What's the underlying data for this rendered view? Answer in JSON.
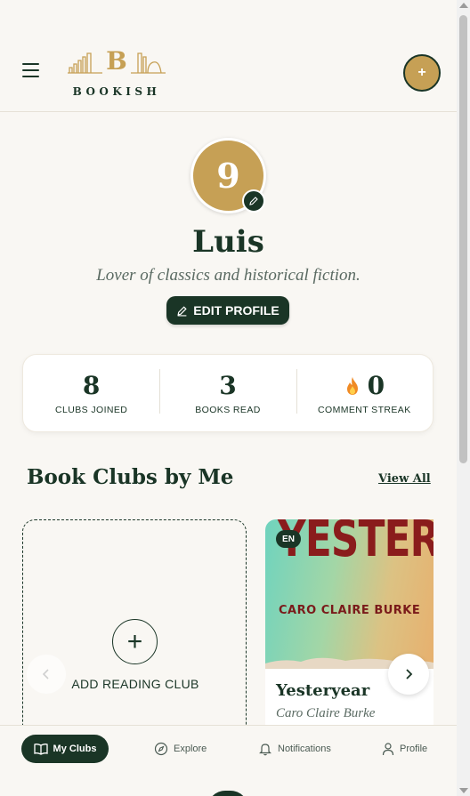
{
  "header": {
    "logo_letter": "B",
    "logo_word": "BOOKISH",
    "create_label": "+"
  },
  "profile": {
    "avatar_initial": "9",
    "name": "Luis",
    "bio": "Lover of classics and historical fiction.",
    "edit_label": "EDIT PROFILE"
  },
  "stats": [
    {
      "value": "8",
      "label": "CLUBS JOINED"
    },
    {
      "value": "3",
      "label": "BOOKS READ"
    },
    {
      "value": "0",
      "label": "COMMENT STREAK"
    }
  ],
  "section": {
    "title": "Book Clubs by Me",
    "view_all": "View All"
  },
  "add_card": {
    "plus": "+",
    "label": "ADD READING CLUB"
  },
  "club": {
    "cover_title": "YESTERYE",
    "cover_author": "CARO CLAIRE BURKE",
    "language": "EN",
    "title": "Yesteryear",
    "author": "Caro Claire Burke"
  },
  "nav": {
    "my_clubs": "My Clubs",
    "explore": "Explore",
    "notifications": "Notifications",
    "profile": "Profile"
  },
  "colors": {
    "brand_dark": "#1a3526",
    "brand_gold": "#c6a055",
    "background": "#f9f7f3"
  },
  "icons": {
    "menu": "hamburger-icon",
    "edit": "pencil-icon",
    "streak": "fire-icon",
    "next": "chevron-right-icon",
    "prev": "chevron-left-icon",
    "my_clubs": "book-open-icon",
    "explore": "compass-icon",
    "notifications": "bell-icon",
    "profile": "user-icon"
  }
}
